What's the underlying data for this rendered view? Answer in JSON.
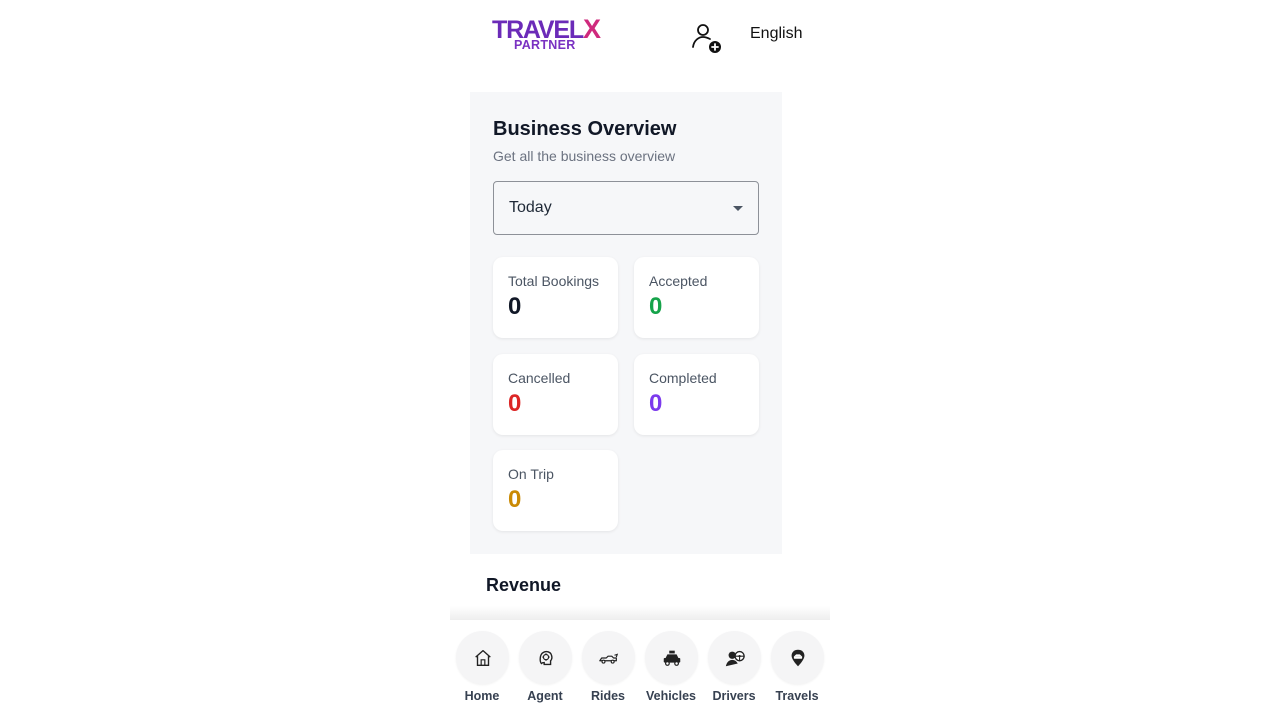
{
  "header": {
    "logo_main": "TRAVEL",
    "logo_x": "X",
    "logo_sub": "PARTNER",
    "user_icon": "user-add-icon",
    "language": "English"
  },
  "overview": {
    "title": "Business Overview",
    "subtitle": "Get all the business overview",
    "period_select": {
      "value": "Today"
    },
    "stats": [
      {
        "label": "Total Bookings",
        "value": "0",
        "color": "#111827"
      },
      {
        "label": "Accepted",
        "value": "0",
        "color": "#16a34a"
      },
      {
        "label": "Cancelled",
        "value": "0",
        "color": "#dc2626"
      },
      {
        "label": "Completed",
        "value": "0",
        "color": "#7c3aed"
      },
      {
        "label": "On Trip",
        "value": "0",
        "color": "#ca8a04"
      }
    ]
  },
  "revenue": {
    "title": "Revenue"
  },
  "nav": [
    {
      "label": "Home",
      "icon": "home-icon"
    },
    {
      "label": "Agent",
      "icon": "agent-icon"
    },
    {
      "label": "Rides",
      "icon": "rides-icon"
    },
    {
      "label": "Vehicles",
      "icon": "vehicles-icon"
    },
    {
      "label": "Drivers",
      "icon": "drivers-icon"
    },
    {
      "label": "Travels",
      "icon": "travels-icon"
    }
  ]
}
